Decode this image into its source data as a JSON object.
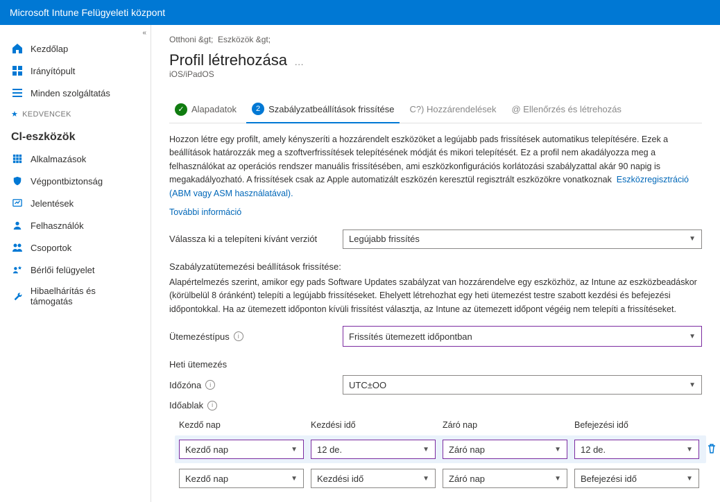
{
  "header": {
    "title": "Microsoft Intune Felügyeleti központ"
  },
  "breadcrumb": {
    "home": "Otthoni &gt;",
    "devices": "Eszközök &gt;"
  },
  "page": {
    "title": "Profil létrehozása",
    "subtitle": "iOS/iPadOS",
    "ellipsis": "…"
  },
  "sidebar": {
    "items": [
      {
        "label": "Kezdőlap",
        "icon": "home"
      },
      {
        "label": "Irányítópult",
        "icon": "dashboard"
      },
      {
        "label": "Minden szolgáltatás",
        "icon": "all"
      }
    ],
    "fav_label": "KEDVENCEK",
    "section_title": "Cl-eszközök",
    "ci_items": [
      {
        "label": "Alkalmazások",
        "icon": "apps"
      },
      {
        "label": "Végpontbiztonság",
        "icon": "shield"
      },
      {
        "label": "Jelentések",
        "icon": "reports"
      },
      {
        "label": "Felhasználók",
        "icon": "user"
      },
      {
        "label": "Csoportok",
        "icon": "groups"
      },
      {
        "label": "Bérlői felügyelet",
        "icon": "tenant"
      },
      {
        "label": "Hibaelhárítás és támogatás",
        "icon": "wrench"
      }
    ]
  },
  "wizard": {
    "steps": [
      {
        "label": "Alapadatok",
        "badge": "✓",
        "state": "done"
      },
      {
        "label": "Szabályzatbeállítások frissítése",
        "badge": "2",
        "state": "curr"
      },
      {
        "label": "Hozzárendelések",
        "badge": "C?)",
        "state": "pending"
      },
      {
        "label": "Ellenőrzés és létrehozás",
        "badge": "@",
        "state": "pending"
      }
    ]
  },
  "intro": {
    "text": "Hozzon létre egy profilt, amely kényszeríti a hozzárendelt eszközöket a legújabb pads frissítések automatikus telepítésére. Ezek a beállítások határozzák meg a szoftverfrissítések telepítésének módját és mikori telepítését. Ez a profil nem akadályozza meg a felhasználókat az operációs rendszer manuális frissítésében, ami eszközkonfigurációs korlátozási szabályzattal akár 90 napig is megakadályozható. A frissítések csak az Apple automatizált eszközén keresztül regisztrált eszközökre vonatkoznak",
    "link_inline": "Eszközregisztráció (ABM vagy ASM használatával).",
    "more_info": "További információ"
  },
  "fields": {
    "version_label": "Válassza ki a telepíteni kívánt verziót",
    "version_value": "Legújabb frissítés",
    "schedule_group_label": "Szabályzatütemezési beállítások frissítése:",
    "schedule_desc": "Alapértelmezés szerint, amikor egy pads Software Updates szabályzat van hozzárendelve egy eszközhöz, az Intune az eszközbeadáskor (körülbelül 8 óránként) telepíti a legújabb frissítéseket. Ehelyett létrehozhat egy heti ütemezést testre szabott kezdési és befejezési időpontokkal. Ha az ütemezett időponton kívüli frissítést választja, az Intune az ütemezett időpont végéig nem telepíti a frissítéseket.",
    "schedule_type_label": "Ütemezéstípus",
    "schedule_type_value": "Frissítés ütemezett időpontban",
    "weekly_label": "Heti ütemezés",
    "tz_label": "Időzóna",
    "tz_value": "UTC±OO",
    "window_label": "Időablak"
  },
  "sched": {
    "cols": {
      "start_day": "Kezdő nap",
      "start_time": "Kezdési idő",
      "end_day": "Záró nap",
      "end_time": "Befejezési idő"
    },
    "rows": [
      {
        "start_day": "Kezdő nap",
        "start_time": "12 de.",
        "end_day": "Záró nap",
        "end_time": "12 de.",
        "trash": true
      },
      {
        "start_day": "Kezdő nap",
        "start_time": "Kezdési idő",
        "end_day": "Záró nap",
        "end_time": "Befejezési idő",
        "trash": false
      }
    ]
  }
}
